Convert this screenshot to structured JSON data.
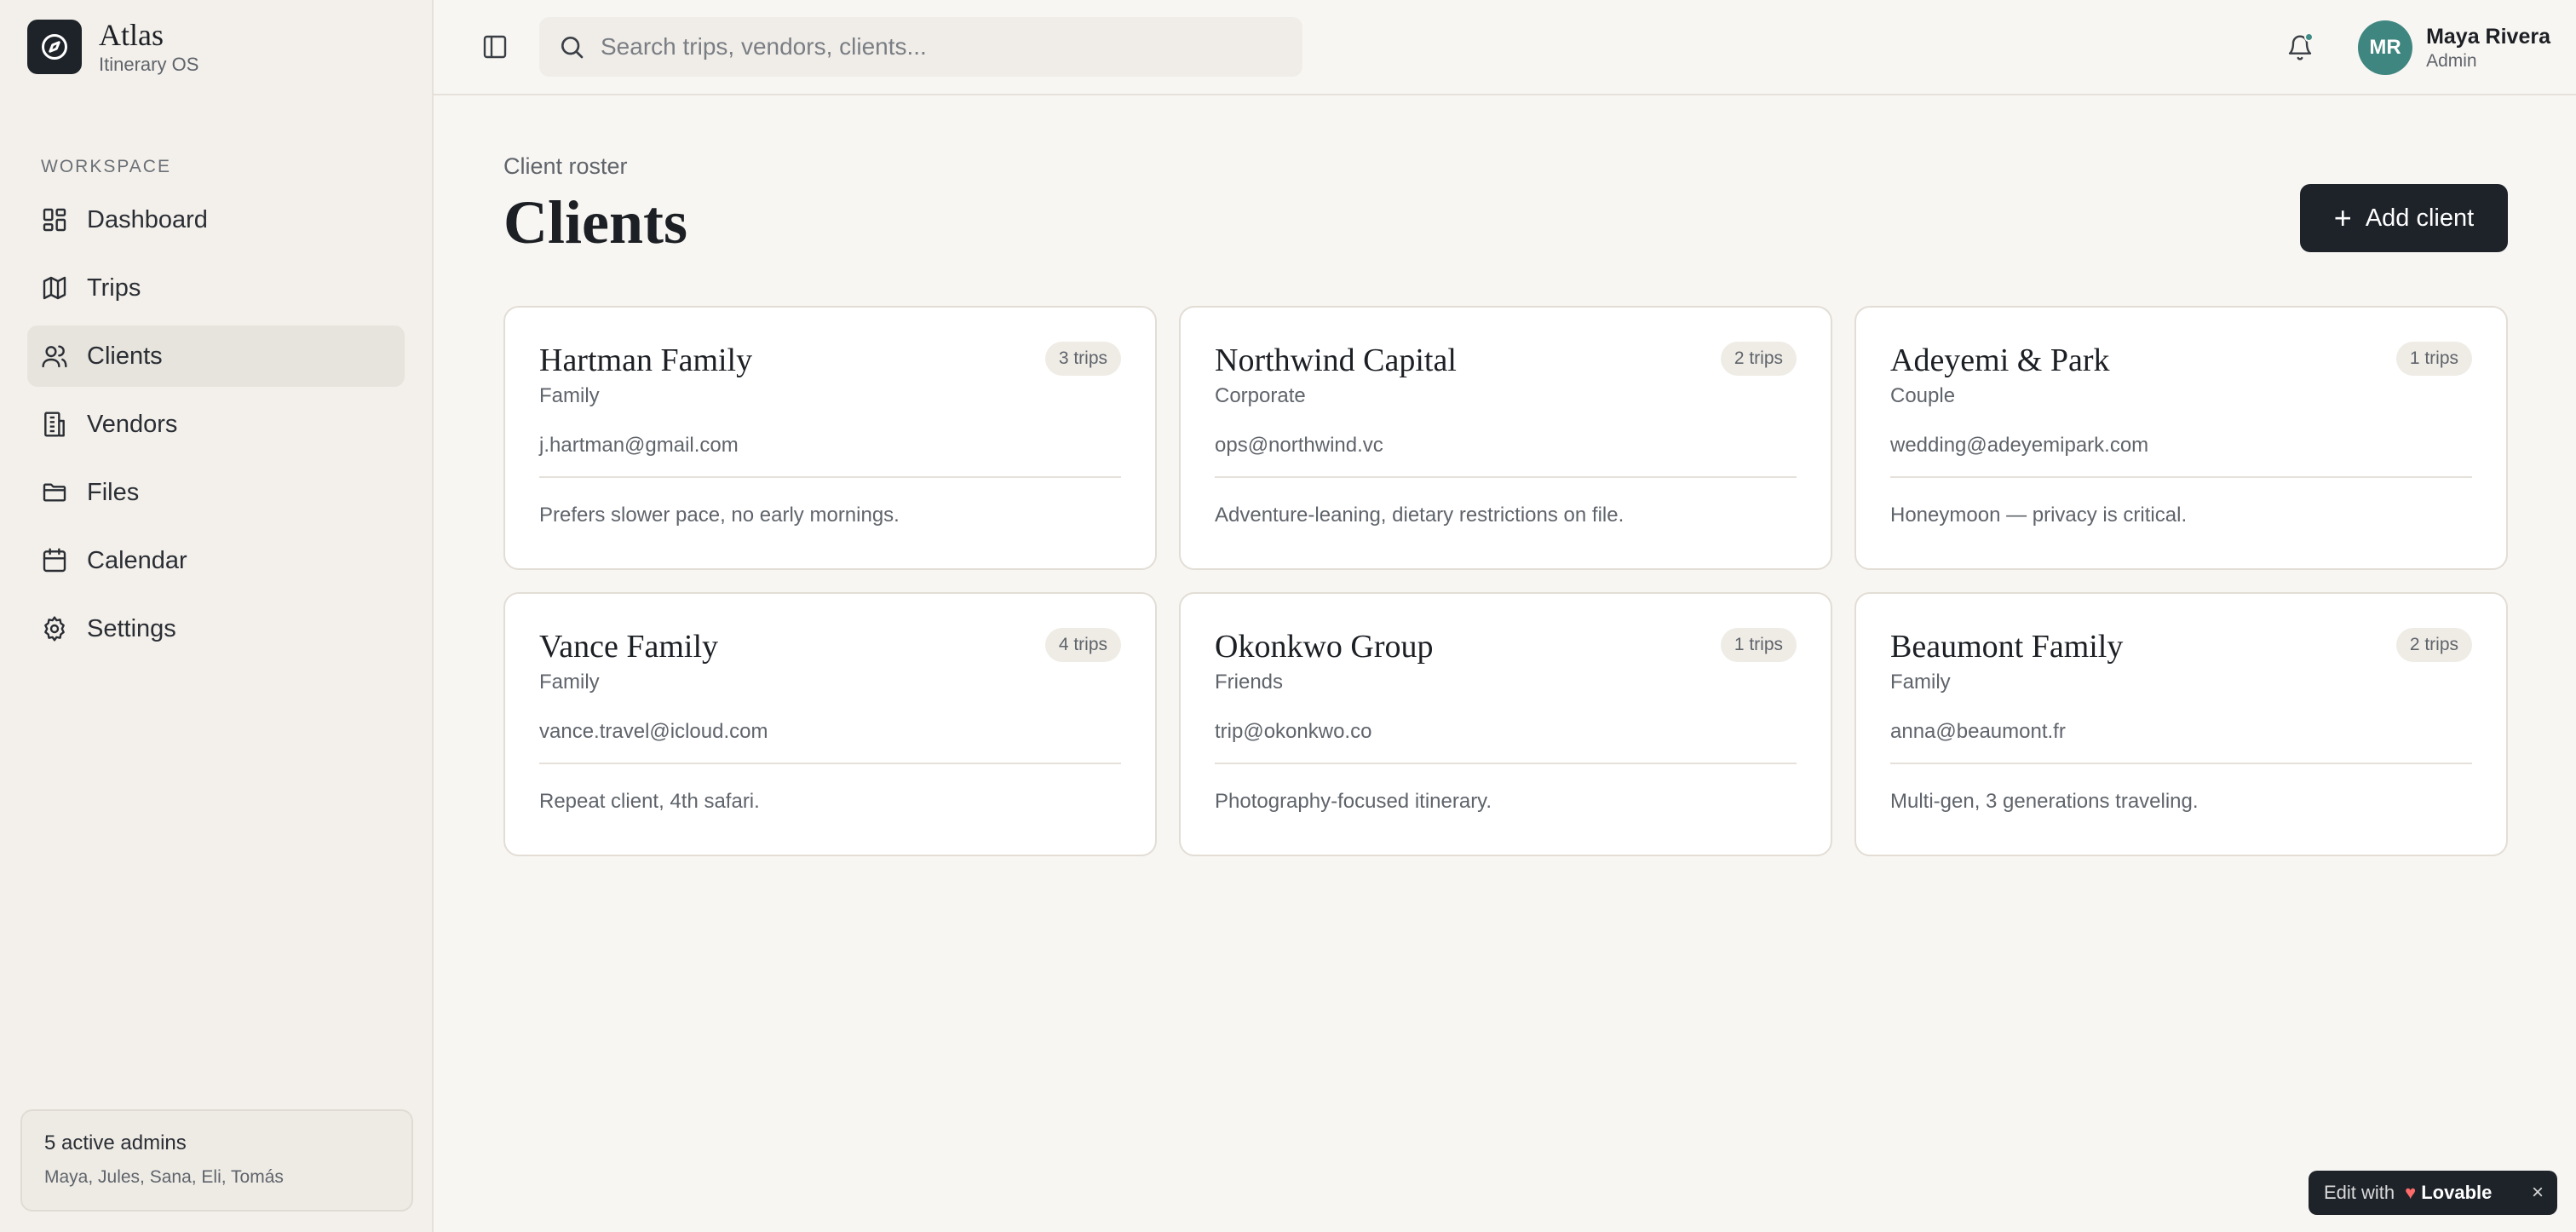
{
  "brand": {
    "name": "Atlas",
    "subtitle": "Itinerary OS"
  },
  "sidebar": {
    "section_label": "WORKSPACE",
    "items": [
      {
        "label": "Dashboard",
        "icon": "dashboard-icon"
      },
      {
        "label": "Trips",
        "icon": "map-icon"
      },
      {
        "label": "Clients",
        "icon": "users-icon",
        "active": true
      },
      {
        "label": "Vendors",
        "icon": "building-icon"
      },
      {
        "label": "Files",
        "icon": "folder-icon"
      },
      {
        "label": "Calendar",
        "icon": "calendar-icon"
      },
      {
        "label": "Settings",
        "icon": "gear-icon"
      }
    ],
    "admins": {
      "title": "5 active admins",
      "names": "Maya, Jules, Sana, Eli, Tomás"
    }
  },
  "topbar": {
    "search_placeholder": "Search trips, vendors, clients...",
    "user": {
      "initials": "MR",
      "name": "Maya Rivera",
      "role": "Admin"
    }
  },
  "page": {
    "eyebrow": "Client roster",
    "title": "Clients",
    "add_button": "Add client"
  },
  "clients": [
    {
      "name": "Hartman Family",
      "type": "Family",
      "email": "j.hartman@gmail.com",
      "note": "Prefers slower pace, no early mornings.",
      "trips": "3 trips"
    },
    {
      "name": "Northwind Capital",
      "type": "Corporate",
      "email": "ops@northwind.vc",
      "note": "Adventure-leaning, dietary restrictions on file.",
      "trips": "2 trips"
    },
    {
      "name": "Adeyemi & Park",
      "type": "Couple",
      "email": "wedding@adeyemipark.com",
      "note": "Honeymoon — privacy is critical.",
      "trips": "1 trips"
    },
    {
      "name": "Vance Family",
      "type": "Family",
      "email": "vance.travel@icloud.com",
      "note": "Repeat client, 4th safari.",
      "trips": "4 trips"
    },
    {
      "name": "Okonkwo Group",
      "type": "Friends",
      "email": "trip@okonkwo.co",
      "note": "Photography-focused itinerary.",
      "trips": "1 trips"
    },
    {
      "name": "Beaumont Family",
      "type": "Family",
      "email": "anna@beaumont.fr",
      "note": "Multi-gen, 3 generations traveling.",
      "trips": "2 trips"
    }
  ],
  "lovable": {
    "edit": "Edit with",
    "brand": "Lovable"
  },
  "colors": {
    "accent": "#1e232a",
    "avatar": "#3f8680",
    "background": "#f8f6f2",
    "sidebar": "#f3f0eb"
  }
}
